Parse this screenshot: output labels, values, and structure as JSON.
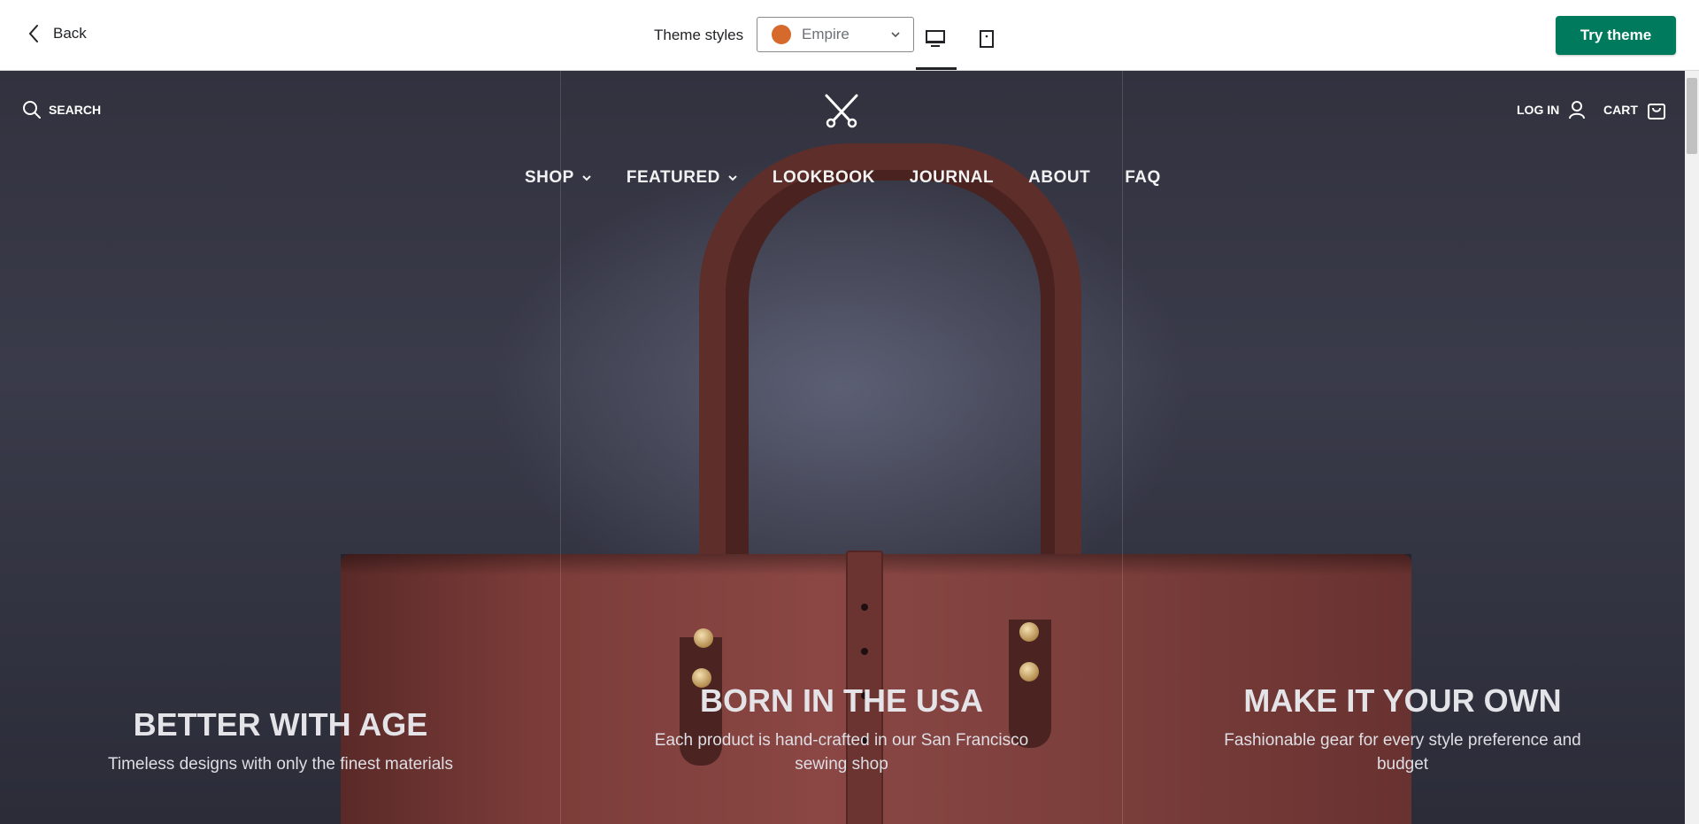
{
  "topbar": {
    "back_label": "Back",
    "theme_styles_label": "Theme styles",
    "theme_select": {
      "value": "Empire",
      "swatch_color": "#d66a2c"
    },
    "view_buttons": [
      "desktop-icon",
      "mobile-icon"
    ],
    "try_label": "Try theme",
    "try_color": "#007a5c"
  },
  "store": {
    "search_label": "SEARCH",
    "logo": "scissors-logo",
    "login_label": "LOG IN",
    "cart_label": "CART",
    "nav": [
      {
        "label": "SHOP",
        "has_dropdown": true
      },
      {
        "label": "FEATURED",
        "has_dropdown": true
      },
      {
        "label": "LOOKBOOK",
        "has_dropdown": false
      },
      {
        "label": "JOURNAL",
        "has_dropdown": false
      },
      {
        "label": "ABOUT",
        "has_dropdown": false
      },
      {
        "label": "FAQ",
        "has_dropdown": false
      }
    ],
    "features": [
      {
        "title": "BETTER WITH AGE",
        "text": "Timeless designs with only the finest materials"
      },
      {
        "title": "BORN IN THE USA",
        "text": "Each product is hand-crafted in our San Francisco sewing shop"
      },
      {
        "title": "MAKE IT YOUR OWN",
        "text": "Fashionable gear for every style preference and budget"
      }
    ]
  }
}
